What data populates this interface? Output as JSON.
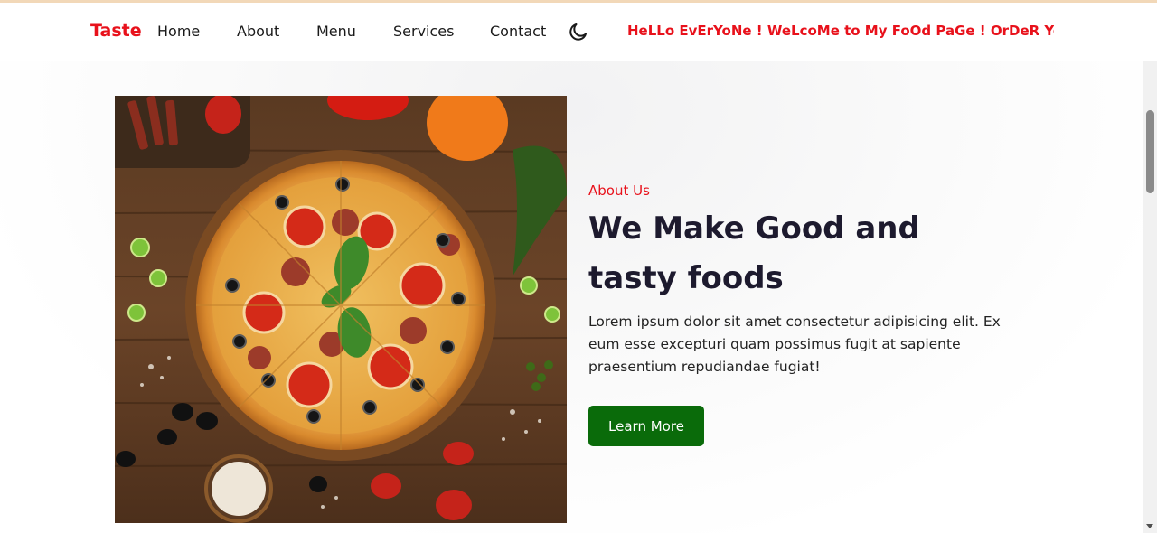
{
  "nav": {
    "brand": "Taste",
    "links": [
      "Home",
      "About",
      "Menu",
      "Services",
      "Contact"
    ],
    "theme_toggle_icon": "moon-icon",
    "marquee": "HeLLo EvErYoNe ! WeLcoMe to My FoOd PaGe ! OrDeR YoUr E"
  },
  "about": {
    "label": "About Us",
    "headline": "We Make Good and tasty foods",
    "description": "Lorem ipsum dolor sit amet consectetur adipisicing elit. Ex eum esse excepturi quam possimus fugit at sapiente praesentium repudiandae fugiat!",
    "button_label": "Learn More",
    "image_icon": "pizza-image"
  },
  "colors": {
    "brand_red": "#e8111b",
    "button_green": "#0a6b0a",
    "heading_dark": "#1d1a2e"
  }
}
